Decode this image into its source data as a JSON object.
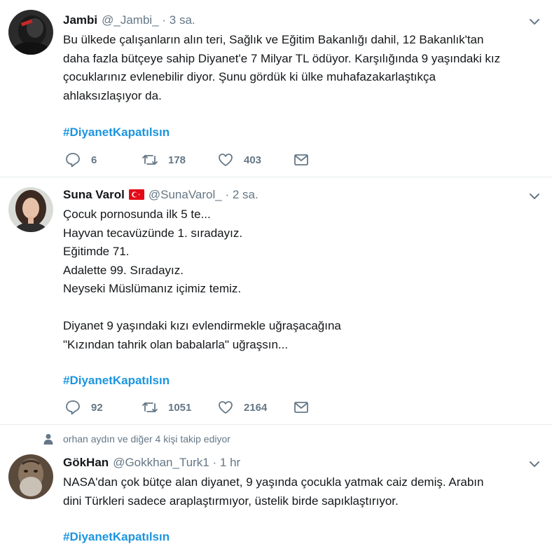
{
  "tweets": [
    {
      "name": "Jambi",
      "handle": "@_Jambi_",
      "time": "3 sa.",
      "lines": [
        "Bu ülkede çalışanların alın teri, Sağlık ve Eğitim Bakanlığı dahil, 12 Bakanlık'tan",
        "daha fazla bütçeye sahip Diyanet'e 7 Milyar TL ödüyor. Karşılığında 9 yaşındaki kız",
        "çocuklarınız evlenebilir diyor. Şunu gördük ki ülke muhafazakarlaştıkça",
        "ahlaksızlaşıyor da."
      ],
      "hashtag": "#DiyanetKapatılsın",
      "replies": "6",
      "retweets": "178",
      "likes": "403"
    },
    {
      "name": "Suna Varol",
      "handle": "@SunaVarol_",
      "time": "2 sa.",
      "lines": [
        "Çocuk pornosunda ilk 5 te...",
        "Hayvan tecavüzünde 1. sıradayız.",
        "Eğitimde 71.",
        "Adalette 99. Sıradayız.",
        "Neyseki Müslümanız içimiz temiz.",
        "",
        "Diyanet 9 yaşındaki kızı evlendirmekle uğraşacağına",
        "\"Kızından tahrik olan babalarla\" uğraşsın..."
      ],
      "hashtag": "#DiyanetKapatılsın",
      "replies": "92",
      "retweets": "1051",
      "likes": "2164"
    },
    {
      "social_context": "orhan aydın ve diğer 4 kişi takip ediyor",
      "name": "GökHan",
      "handle": "@Gokkhan_Turk1",
      "time": "1 hr",
      "lines": [
        "NASA'dan çok bütçe alan diyanet, 9 yaşında çocukla yatmak caiz demiş. Arabın",
        "dini Türkleri sadece araplaştırmıyor, üstelik birde sapıklaştırıyor."
      ],
      "hashtag": "#DiyanetKapatılsın"
    }
  ],
  "separator": "·",
  "icons": {
    "reply": "reply-icon",
    "retweet": "retweet-icon",
    "like": "heart-icon",
    "dm": "envelope-icon",
    "caret": "chevron-down-icon",
    "flag": "turkey-flag-icon",
    "person": "person-icon"
  },
  "colors": {
    "name": "#14171a",
    "secondary": "#657786",
    "hashtag": "#1b95e0",
    "divider": "#e6ecf0",
    "flag": "#e30a17"
  }
}
